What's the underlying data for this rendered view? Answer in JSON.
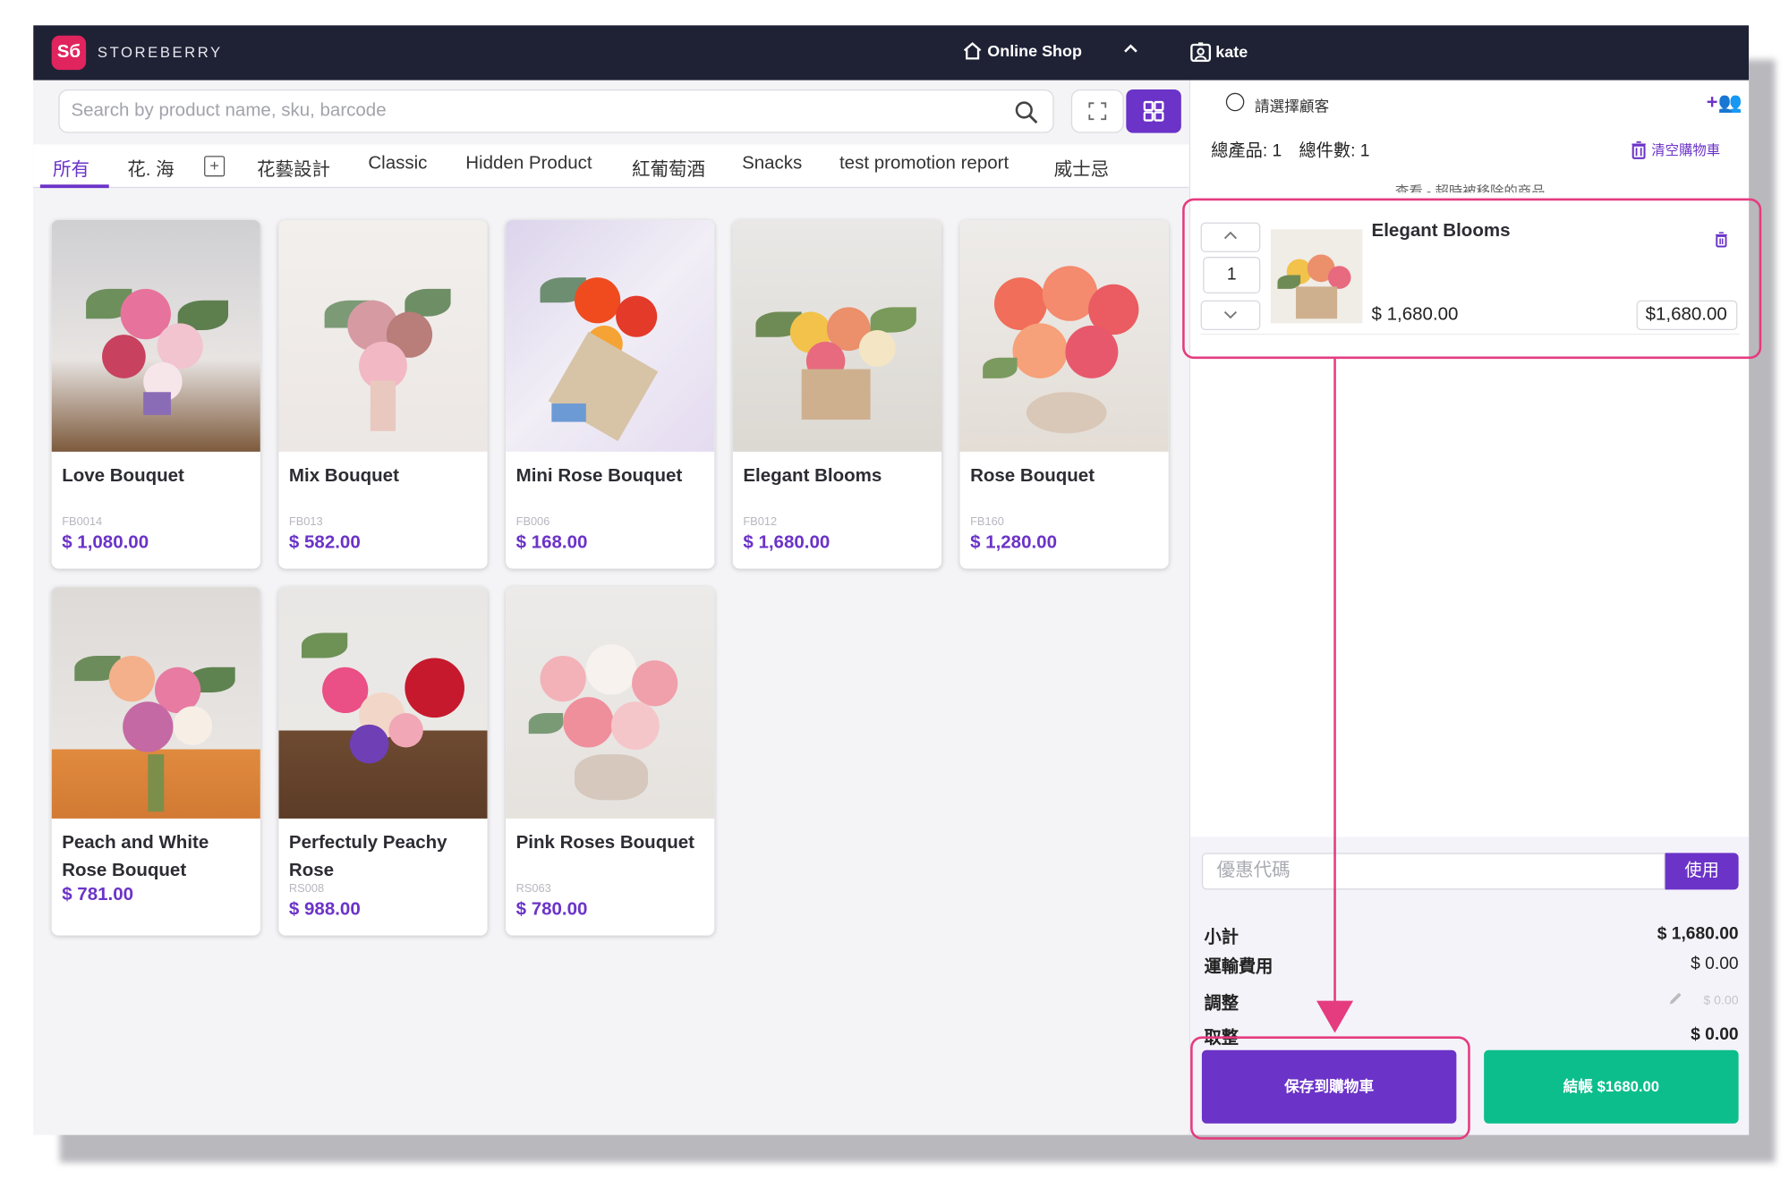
{
  "topbar": {
    "logo_text": "Sб",
    "brand": "STOREBERRY",
    "shop": "Online Shop",
    "user": "kate"
  },
  "search": {
    "placeholder": "Search by product name, sku, barcode"
  },
  "tabs": [
    "所有",
    "花. 海",
    "花藝設計",
    "Classic",
    "Hidden Product",
    "紅葡萄酒",
    "Snacks",
    "test promotion report",
    "威士忌"
  ],
  "products": [
    {
      "name": "Love Bouquet",
      "sku": "FB0014",
      "price": "$ 1,080.00"
    },
    {
      "name": "Mix Bouquet",
      "sku": "FB013",
      "price": "$ 582.00"
    },
    {
      "name": "Mini Rose Bouquet",
      "sku": "FB006",
      "price": "$ 168.00"
    },
    {
      "name": "Elegant Blooms",
      "sku": "FB012",
      "price": "$ 1,680.00"
    },
    {
      "name": "Rose Bouquet",
      "sku": "FB160",
      "price": "$ 1,280.00"
    },
    {
      "name": "Peach and White Rose Bouquet",
      "sku": "",
      "price": "$ 781.00"
    },
    {
      "name": "Perfectuly Peachy Rose",
      "sku": "RS008",
      "price": "$ 988.00"
    },
    {
      "name": "Pink Roses Bouquet",
      "sku": "RS063",
      "price": "$ 780.00"
    }
  ],
  "cart": {
    "select_customer": "請選擇顧客",
    "totals": "總產品: 1　總件數: 1",
    "clear": "清空購物車",
    "removed_note": "查看 - 超時被移除的商品",
    "item": {
      "name": "Elegant Blooms",
      "qty": "1",
      "price": "$ 1,680.00",
      "line_total": "$1,680.00"
    }
  },
  "summary": {
    "coupon_placeholder": "優惠代碼",
    "apply": "使用",
    "subtotal_label": "小計",
    "subtotal": "$ 1,680.00",
    "shipping_label": "運輸費用",
    "shipping": "$ 0.00",
    "adjust_label": "調整",
    "adjust": "$ 0.00",
    "rounding_label": "取整",
    "rounding": "$ 0.00",
    "save_button": "保存到購物車",
    "checkout_button": "結帳 $1680.00"
  },
  "colors": {
    "topbar": "#1f2235",
    "accent": "#6b33c8",
    "checkout": "#0cbe8c",
    "annotation": "#e53b7f"
  }
}
